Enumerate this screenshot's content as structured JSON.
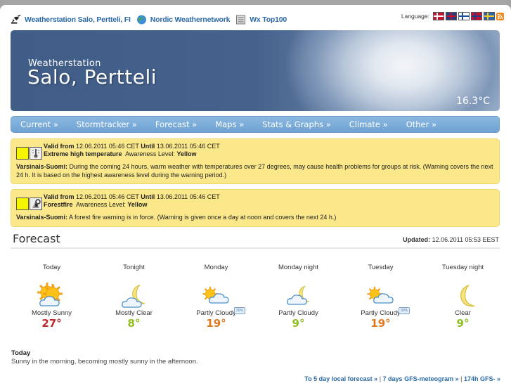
{
  "topbar": {
    "links": [
      {
        "label": "Weatherstation Salo, Pertteli, FI",
        "icon": "satellite-dish-icon"
      },
      {
        "label": "Nordic Weathernetwork",
        "icon": "globe-icon"
      },
      {
        "label": "Wx Top100",
        "icon": "list-icon"
      }
    ],
    "language_label": "Language:",
    "languages": [
      "Danish",
      "English",
      "Finnish",
      "Norwegian",
      "Swedish"
    ],
    "rss": "rss-icon"
  },
  "banner": {
    "subtitle": "Weatherstation",
    "title": "Salo, Pertteli",
    "temperature": "16.3°C"
  },
  "nav": {
    "items": [
      "Current »",
      "Stormtracker »",
      "Forecast »",
      "Maps »",
      "Stats & Graphs »",
      "Climate »",
      "Other »"
    ]
  },
  "warnings": [
    {
      "valid_from_label": "Valid from",
      "valid_from": "12.06.2011 05:46 CET",
      "until_label": "Until",
      "until": "13.06.2011 05:46 CET",
      "type": "Extreme high temperature",
      "awareness_label": "Awareness Level:",
      "awareness": "Yellow",
      "level_color": "#f5f500",
      "icon": "thermometer-icon",
      "region": "Varsinais-Suomi:",
      "description": "During the coming 24 hours, warm weather with temperatures over 27 degrees, may cause health problems for groups at risk. (Warning covers the next 24 h. It is based on the highest awareness level during the warning period.)"
    },
    {
      "valid_from_label": "Valid from",
      "valid_from": "12.06.2011 05:46 CET",
      "until_label": "Until",
      "until": "13.06.2011 05:46 CET",
      "type": "Forestfire",
      "awareness_label": "Awareness Level:",
      "awareness": "Yellow",
      "level_color": "#f5f500",
      "icon": "forestfire-icon",
      "region": "Varsinais-Suomi:",
      "description": "A forest fire warning is in force. (Warning is given once a day at noon and covers the next 24 h.)"
    }
  ],
  "forecast": {
    "title": "Forecast",
    "updated_label": "Updated:",
    "updated": "12.06.2011 05:53 EEST",
    "days": [
      {
        "name": "Today",
        "condition": "Mostly Sunny",
        "temp": "27°",
        "temp_color": "#c0282a",
        "icon": "mostly-sunny-icon",
        "pop": ""
      },
      {
        "name": "Tonight",
        "condition": "Mostly Clear",
        "temp": "8°",
        "temp_color": "#8fc11e",
        "icon": "mostly-clear-night-icon",
        "pop": ""
      },
      {
        "name": "Monday",
        "condition": "Partly Cloudy",
        "temp": "19°",
        "temp_color": "#e0781c",
        "icon": "partly-cloudy-icon",
        "pop": "30%"
      },
      {
        "name": "Monday night",
        "condition": "Partly Cloudy",
        "temp": "9°",
        "temp_color": "#8fc11e",
        "icon": "partly-cloudy-night-icon",
        "pop": ""
      },
      {
        "name": "Tuesday",
        "condition": "Partly Cloudy",
        "temp": "19°",
        "temp_color": "#e0781c",
        "icon": "partly-cloudy-icon",
        "pop": "30%"
      },
      {
        "name": "Tuesday night",
        "condition": "Clear",
        "temp": "9°",
        "temp_color": "#8fc11e",
        "icon": "clear-night-icon",
        "pop": ""
      }
    ],
    "today_title": "Today",
    "today_text": "Sunny in the morning, becoming mostly sunny in the afternoon."
  },
  "bottom_links": [
    "To 5 day local forecast »",
    "7 days GFS-meteogram »",
    "174h GFS- »"
  ],
  "bottom_separator": "|"
}
